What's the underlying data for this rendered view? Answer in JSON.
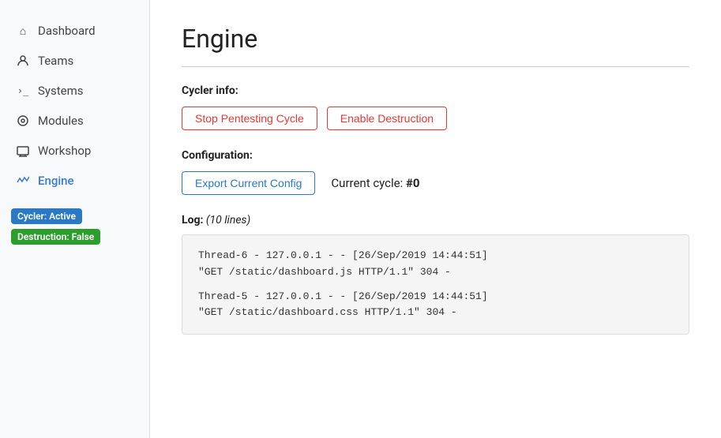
{
  "sidebar": {
    "items": [
      {
        "id": "dashboard",
        "label": "Dashboard",
        "icon": "🏠",
        "active": false
      },
      {
        "id": "teams",
        "label": "Teams",
        "icon": "👤",
        "active": false
      },
      {
        "id": "systems",
        "label": "Systems",
        "icon": ">_",
        "active": false
      },
      {
        "id": "modules",
        "label": "Modules",
        "icon": "⊙",
        "active": false
      },
      {
        "id": "workshop",
        "label": "Workshop",
        "icon": "🖥",
        "active": false
      },
      {
        "id": "engine",
        "label": "Engine",
        "icon": "~",
        "active": true
      }
    ],
    "badges": [
      {
        "id": "cycler",
        "label": "Cycler: Active",
        "color": "blue"
      },
      {
        "id": "destruction",
        "label": "Destruction: False",
        "color": "green"
      }
    ]
  },
  "main": {
    "page_title": "Engine",
    "cycler_section": {
      "label": "Cycler info:",
      "buttons": [
        {
          "id": "stop-cycle",
          "label": "Stop Pentesting Cycle",
          "style": "red"
        },
        {
          "id": "enable-destruction",
          "label": "Enable Destruction",
          "style": "red"
        }
      ]
    },
    "config_section": {
      "label": "Configuration:",
      "export_button": "Export Current Config",
      "cycle_text": "Current cycle: ",
      "cycle_value": "#0"
    },
    "log_section": {
      "label": "Log: ",
      "lines_note": "(10 lines)",
      "entries": [
        {
          "line1": "Thread-6 - 127.0.0.1 - - [26/Sep/2019 14:44:51]",
          "line2": "\"GET /static/dashboard.js HTTP/1.1\" 304 -"
        },
        {
          "line1": "Thread-5 - 127.0.0.1 - - [26/Sep/2019 14:44:51]",
          "line2": "\"GET /static/dashboard.css HTTP/1.1\" 304 -"
        }
      ]
    }
  }
}
